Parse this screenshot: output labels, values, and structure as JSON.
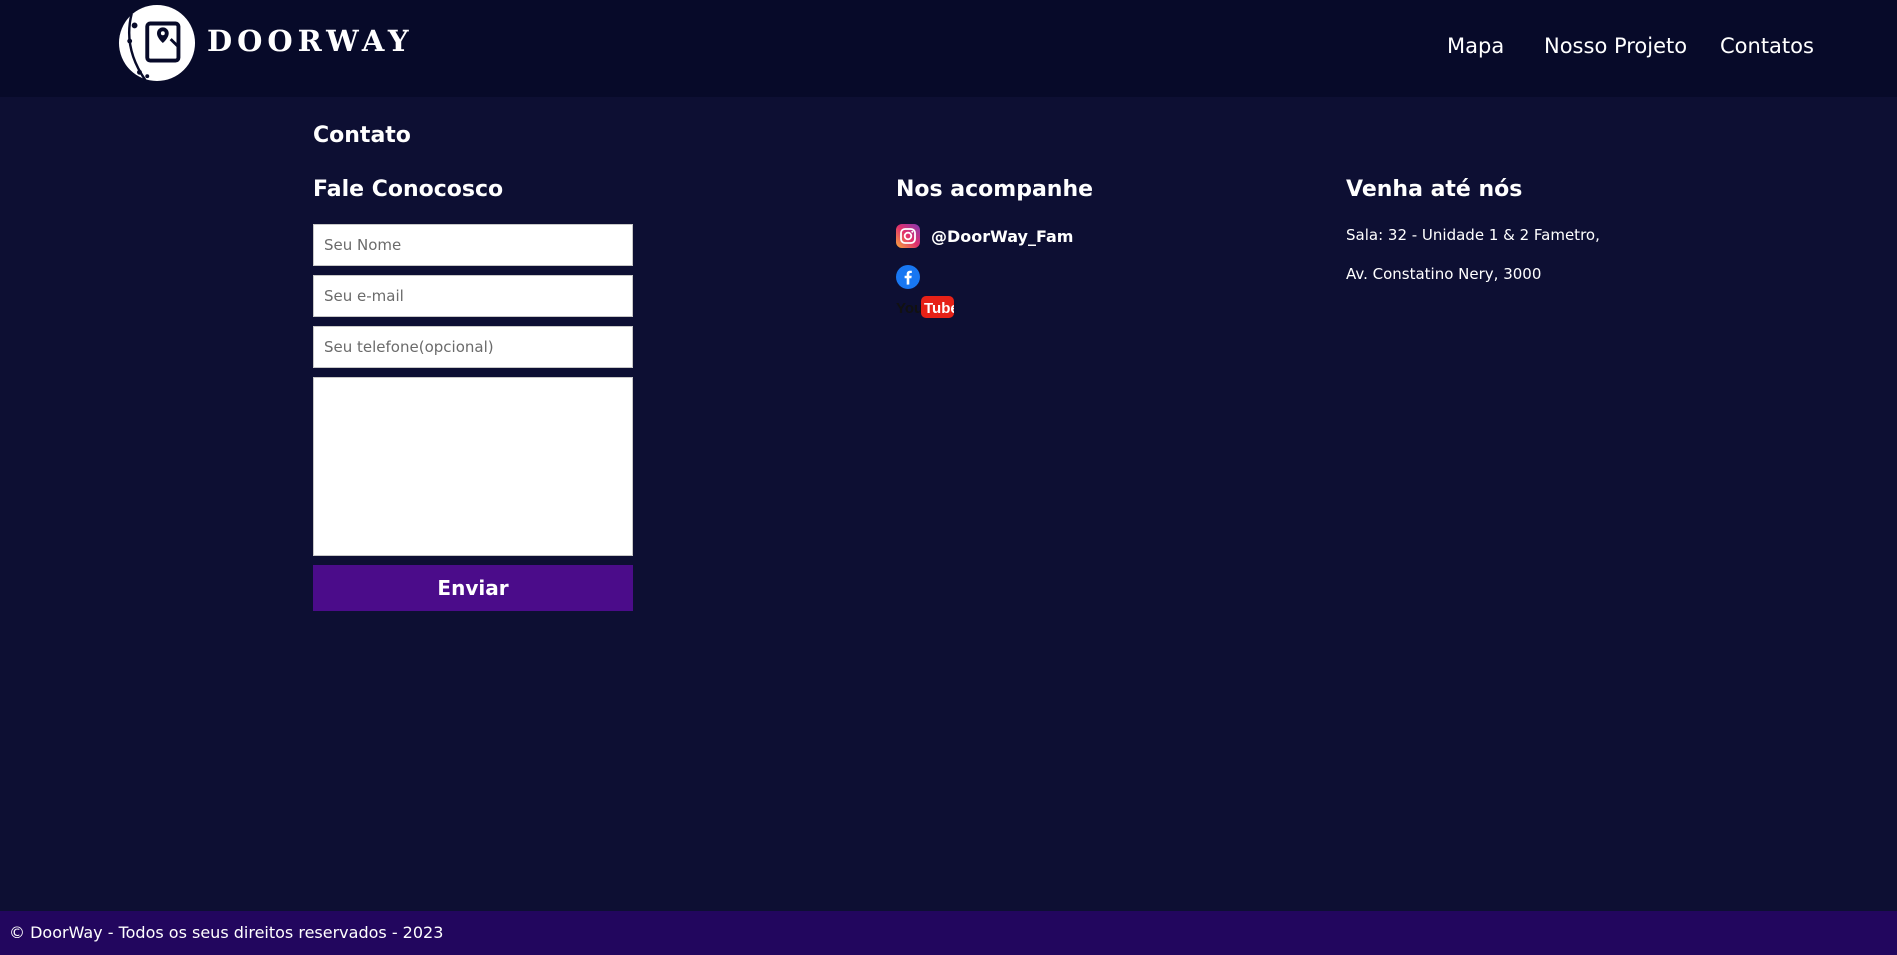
{
  "header": {
    "brand": "DOORWAY",
    "nav": [
      {
        "label": "Mapa"
      },
      {
        "label": "Nosso Projeto"
      },
      {
        "label": "Contatos"
      }
    ]
  },
  "main": {
    "title": "Contato",
    "form": {
      "title": "Fale Conocosco",
      "name_placeholder": "Seu Nome",
      "email_placeholder": "Seu e-mail",
      "phone_placeholder": "Seu telefone(opcional)",
      "message_placeholder": "",
      "submit_label": "Enviar"
    },
    "social": {
      "title": "Nos acompanhe",
      "instagram_handle": "@DoorWay_Fam",
      "icons": [
        "instagram-icon",
        "facebook-icon",
        "youtube-icon"
      ]
    },
    "location": {
      "title": "Venha até nós",
      "line1": "Sala: 32 - Unidade 1 & 2 Fametro,",
      "line2": "Av. Constatino Nery, 3000"
    }
  },
  "footer": {
    "text": "© DoorWay - Todos os seus direitos reservados - 2023"
  },
  "colors": {
    "background": "#0d0f33",
    "header": "#070a29",
    "button": "#4b0c8a",
    "footer": "#22065e"
  }
}
